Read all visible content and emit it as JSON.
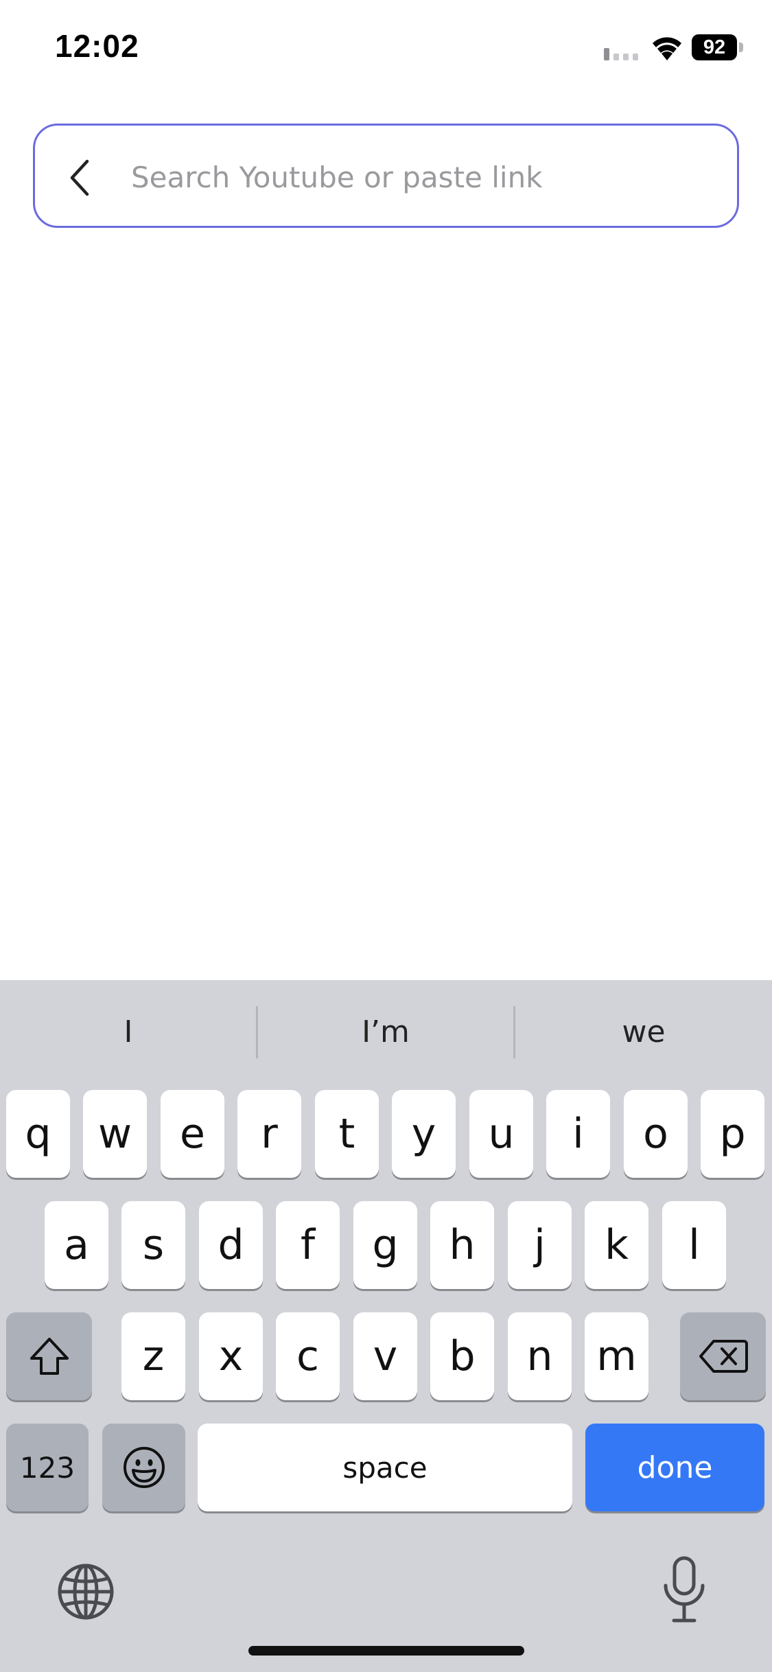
{
  "status_bar": {
    "time": "12:02",
    "battery_level": "92",
    "battery_fraction": 0.92
  },
  "search": {
    "placeholder": "Search Youtube or paste link",
    "value": "",
    "border_color": "#6b6be0"
  },
  "keyboard": {
    "predictions": [
      "I",
      "I’m",
      "we"
    ],
    "row1": [
      "q",
      "w",
      "e",
      "r",
      "t",
      "y",
      "u",
      "i",
      "o",
      "p"
    ],
    "row2": [
      "a",
      "s",
      "d",
      "f",
      "g",
      "h",
      "j",
      "k",
      "l"
    ],
    "row3": [
      "z",
      "x",
      "c",
      "v",
      "b",
      "n",
      "m"
    ],
    "numbers_label": "123",
    "space_label": "space",
    "done_label": "done",
    "done_color": "#3478f6"
  },
  "icons": {
    "back": "chevron-left-icon",
    "shift": "shift-icon",
    "delete": "delete-backspace-icon",
    "emoji": "emoji-icon",
    "globe": "globe-icon",
    "mic": "microphone-icon"
  }
}
